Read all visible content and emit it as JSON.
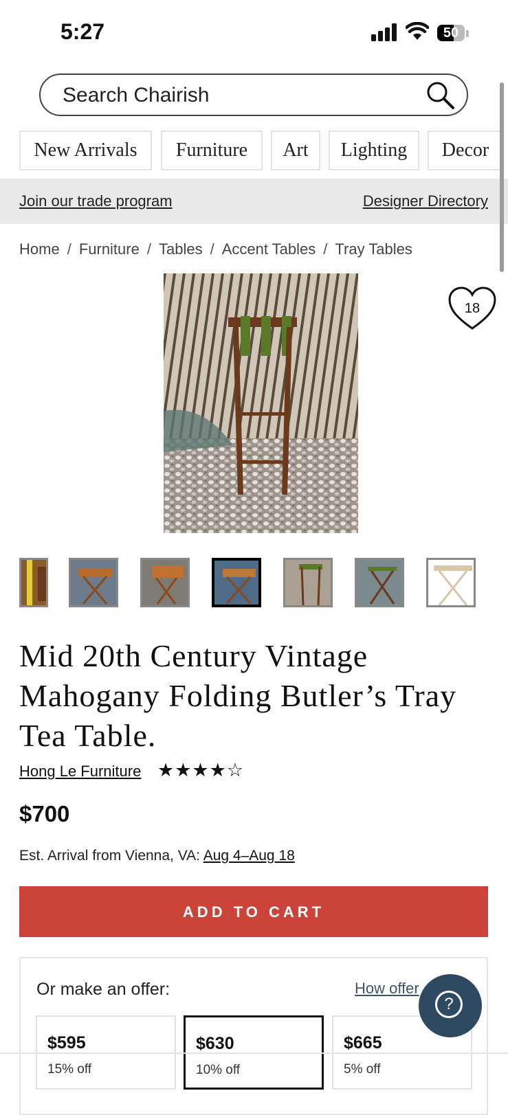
{
  "status_bar": {
    "time": "5:27",
    "battery": "50"
  },
  "search": {
    "placeholder": "Search Chairish"
  },
  "categories": [
    "New Arrivals",
    "Furniture",
    "Art",
    "Lighting",
    "Decor"
  ],
  "trade": {
    "join": "Join our trade program",
    "directory": "Designer Directory"
  },
  "breadcrumbs": [
    "Home",
    "Furniture",
    "Tables",
    "Accent Tables",
    "Tray Tables"
  ],
  "breadcrumb_separator": "/",
  "favorite": {
    "count": "18",
    "icon": "heart-icon"
  },
  "product": {
    "title": "Mid 20th Century Vintage Mahogany Folding Butler’s Tray Tea Table.",
    "seller": "Hong Le Furniture",
    "rating": 4,
    "rating_max": 5,
    "stars": "★★★★☆",
    "price": "$700",
    "arrival_prefix": "Est. Arrival from Vienna, VA:",
    "arrival_dates": "Aug 4–Aug 18",
    "add_to_cart": "ADD TO CART"
  },
  "offer": {
    "label": "Or make an offer:",
    "how_link": "How offer",
    "options": [
      {
        "price": "$595",
        "off": "15% off"
      },
      {
        "price": "$630",
        "off": "10% off"
      },
      {
        "price": "$665",
        "off": "5% off"
      }
    ],
    "selected_index": 1
  },
  "help_button": {
    "icon": "question-icon",
    "label": "?"
  },
  "colors": {
    "accent": "#cc4439",
    "help": "#2e4a63",
    "link": "#3b5570"
  }
}
